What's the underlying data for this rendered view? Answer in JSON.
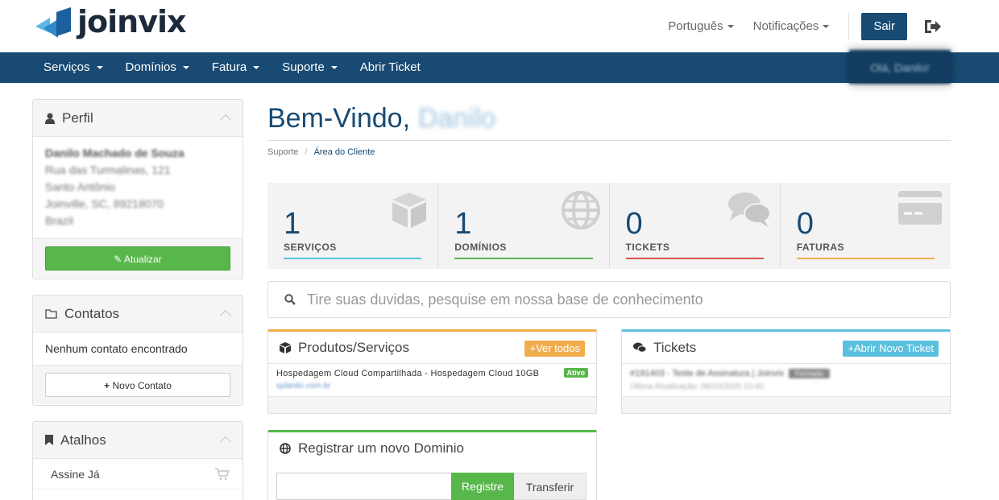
{
  "brand": {
    "name": "joinvix"
  },
  "topbar": {
    "language": "Português",
    "notifications": "Notificações",
    "logout_label": "Sair"
  },
  "nav": {
    "items": [
      {
        "label": "Serviços",
        "dropdown": true
      },
      {
        "label": "Domínios",
        "dropdown": true
      },
      {
        "label": "Fatura",
        "dropdown": true
      },
      {
        "label": "Suporte",
        "dropdown": true
      },
      {
        "label": "Abrir Ticket",
        "dropdown": false
      }
    ],
    "user_menu": "Olá, Danilo!"
  },
  "sidebar": {
    "profile": {
      "title": "Perfil",
      "name": "Danilo Machado de Souza",
      "lines": [
        "Rua das Turmalinas, 121",
        "Santo Antônio",
        "Joinville, SC, 89218070",
        "Brazil"
      ],
      "button": "Atualizar"
    },
    "contacts": {
      "title": "Contatos",
      "empty": "Nenhum contato encontrado",
      "button": "Novo Contato"
    },
    "shortcuts": {
      "title": "Atalhos",
      "items": [
        "Assine Já"
      ]
    }
  },
  "main": {
    "welcome": "Bem-Vindo,",
    "user_name": "Danilo",
    "breadcrumb": [
      "Suporte",
      "Área do Cliente"
    ],
    "stats": [
      {
        "value": "1",
        "label": "SERVIÇOS",
        "color": "#5bc0de",
        "icon": "cube-icon"
      },
      {
        "value": "1",
        "label": "DOMÍNIOS",
        "color": "#58b74a",
        "icon": "globe-icon"
      },
      {
        "value": "0",
        "label": "TICKETS",
        "color": "#d9534f",
        "icon": "comments-icon"
      },
      {
        "value": "0",
        "label": "FATURAS",
        "color": "#f0ad4e",
        "icon": "credit-card-icon"
      }
    ],
    "search_placeholder": "Tire suas duvidas, pesquise em nossa base de conhecimento",
    "products": {
      "title": "Produtos/Serviços",
      "button": "Ver todos",
      "accent": "#f0ad4e",
      "items": [
        {
          "name": "Hospedagem Cloud Compartilhada - Hospedagem Cloud 10GB",
          "domain": "sjdanilo.com.br",
          "status": "Ativo"
        }
      ]
    },
    "tickets": {
      "title": "Tickets",
      "button": "Abrir Novo Ticket",
      "accent": "#5bc0de",
      "items": [
        {
          "title": "#191403 - Teste de Assinatura | Joinvix",
          "status": "Fechado",
          "updated": "Última Atualização: 08/10/2020 10:40"
        }
      ]
    },
    "domain": {
      "title": "Registrar um novo Dominio",
      "accent": "#58b74a",
      "register": "Registre",
      "transfer": "Transferir"
    }
  }
}
